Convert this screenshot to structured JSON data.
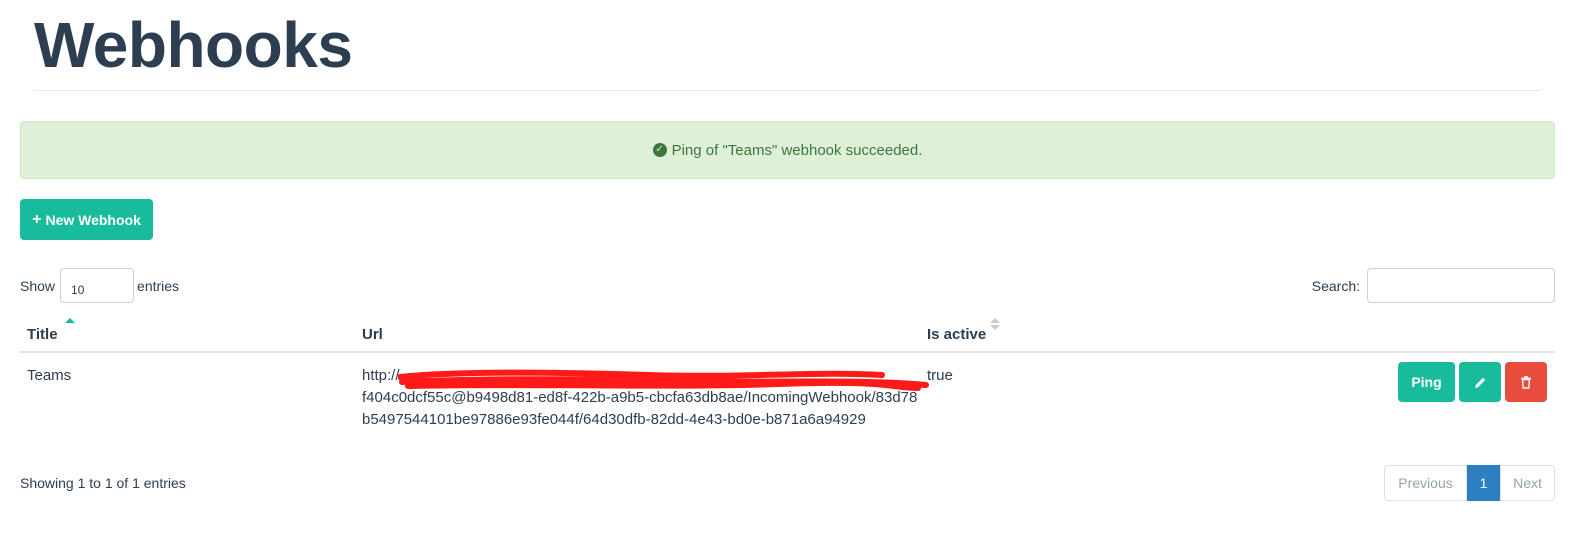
{
  "page": {
    "title": "Webhooks"
  },
  "alert": {
    "icon": "check-circle-icon",
    "message": "Ping of \"Teams\" webhook succeeded."
  },
  "toolbar": {
    "new_icon": "plus-icon",
    "new_label": "New Webhook"
  },
  "length": {
    "prefix": "Show",
    "value": "10",
    "suffix": "entries"
  },
  "search": {
    "label": "Search:",
    "value": ""
  },
  "table": {
    "columns": [
      "Title",
      "Url",
      "Is active"
    ],
    "rows": [
      {
        "title": "Teams",
        "url": "http://",
        "url_rest": "f404c0dcf55c@b9498d81-ed8f-422b-a9b5-cbcfa63db8ae/IncomingWebhook/83d78b5497544101be97886e93fe044f/64d30dfb-82dd-4e43-bd0e-b871a6a94929",
        "is_active": "true",
        "actions": {
          "ping": "Ping",
          "edit_icon": "pencil-icon",
          "delete_icon": "trash-icon"
        }
      }
    ]
  },
  "info": "Showing 1 to 1 of 1 entries",
  "pagination": {
    "previous": "Previous",
    "current": "1",
    "next": "Next"
  },
  "colors": {
    "accent": "#18bc9c",
    "danger": "#e74c3c",
    "success_bg": "#dff0d8",
    "active_page": "#2c7fc0",
    "redaction": "#ff1a1a"
  }
}
